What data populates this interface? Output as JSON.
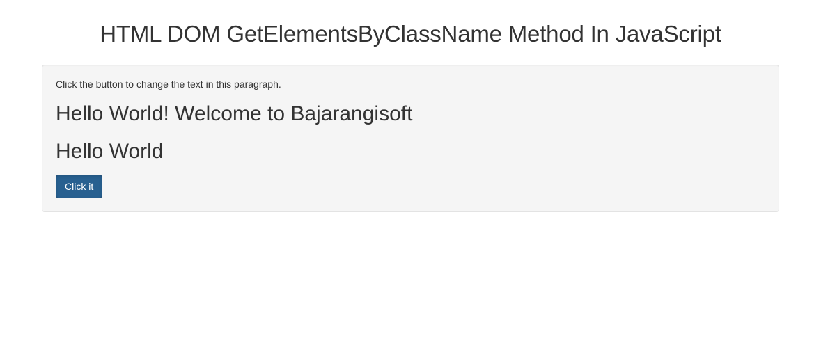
{
  "title": "HTML DOM GetElementsByClassName Method In JavaScript",
  "well": {
    "instruction": "Click the button to change the text in this paragraph.",
    "heading1": "Hello World! Welcome to Bajarangisoft",
    "heading2": "Hello World",
    "button_label": "Click it"
  }
}
